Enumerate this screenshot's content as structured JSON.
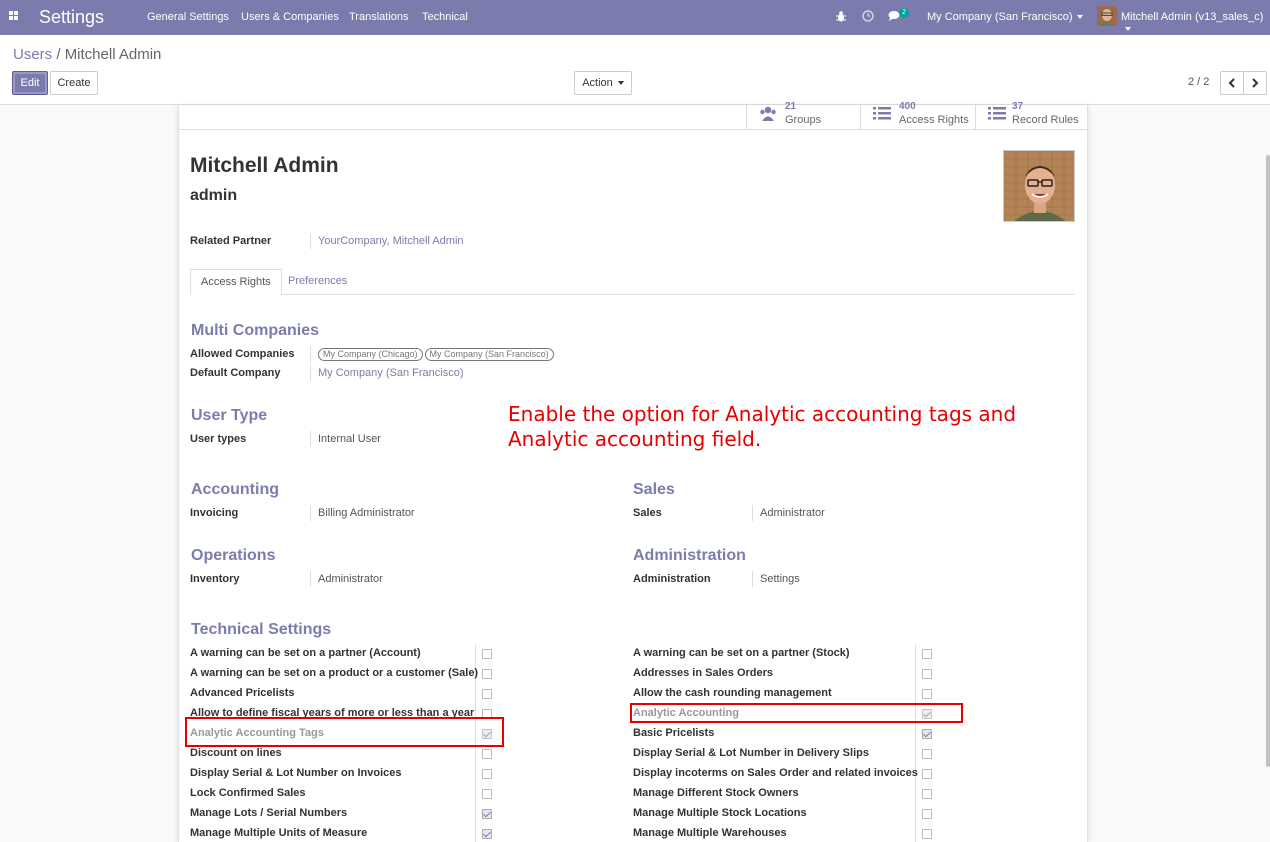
{
  "navbar": {
    "app_title": "Settings",
    "menu": [
      "General Settings",
      "Users & Companies",
      "Translations",
      "Technical"
    ],
    "chat_badge": "2",
    "company_switcher": "My Company (San Francisco)",
    "user_menu": "Mitchell Admin (v13_sales_c)",
    "bg_color": "#7c7bad",
    "icons": [
      "apps-icon",
      "bug-icon",
      "clock-icon",
      "chat-icon"
    ]
  },
  "breadcrumb": {
    "parent": "Users",
    "separator": "/",
    "current": "Mitchell Admin"
  },
  "toolbar": {
    "edit_label": "Edit",
    "create_label": "Create",
    "action_label": "Action",
    "pager": "2 / 2"
  },
  "stats": [
    {
      "count": "21",
      "label": "Groups",
      "icon": "users-icon"
    },
    {
      "count": "400",
      "label": "Access Rights",
      "icon": "list-icon"
    },
    {
      "count": "37",
      "label": "Record Rules",
      "icon": "list-icon"
    }
  ],
  "user": {
    "name": "Mitchell Admin",
    "login": "admin",
    "related_partner_label": "Related Partner",
    "related_partner_value": "YourCompany, Mitchell Admin"
  },
  "tabs": [
    "Access Rights",
    "Preferences"
  ],
  "multi_companies": {
    "title": "Multi Companies",
    "allowed_label": "Allowed Companies",
    "allowed_values": [
      "My Company (Chicago)",
      "My Company (San Francisco)"
    ],
    "default_label": "Default Company",
    "default_value": "My Company (San Francisco)"
  },
  "user_type": {
    "title": "User Type",
    "label": "User types",
    "value": "Internal User"
  },
  "annotation": {
    "line1": "Enable the option for Analytic accounting tags and",
    "line2": "Analytic accounting field.",
    "color": "#e60000"
  },
  "accounting": {
    "title": "Accounting",
    "label": "Invoicing",
    "value": "Billing Administrator"
  },
  "sales": {
    "title": "Sales",
    "label": "Sales",
    "value": "Administrator"
  },
  "operations": {
    "title": "Operations",
    "label": "Inventory",
    "value": "Administrator"
  },
  "administration": {
    "title": "Administration",
    "label": "Administration",
    "value": "Settings"
  },
  "technical": {
    "title": "Technical Settings",
    "left": [
      {
        "label": "A warning can be set on a partner (Account)",
        "checked": false
      },
      {
        "label": "A warning can be set on a product or a customer (Sale)",
        "checked": false
      },
      {
        "label": "Advanced Pricelists",
        "checked": false
      },
      {
        "label": "Allow to define fiscal years of more or less than a year",
        "checked": false
      },
      {
        "label": "Analytic Accounting Tags",
        "checked": true,
        "muted": true
      },
      {
        "label": "Discount on lines",
        "checked": false
      },
      {
        "label": "Display Serial & Lot Number on Invoices",
        "checked": false
      },
      {
        "label": "Lock Confirmed Sales",
        "checked": false
      },
      {
        "label": "Manage Lots / Serial Numbers",
        "checked": true
      },
      {
        "label": "Manage Multiple Units of Measure",
        "checked": true
      }
    ],
    "right": [
      {
        "label": "A warning can be set on a partner (Stock)",
        "checked": false
      },
      {
        "label": "Addresses in Sales Orders",
        "checked": false
      },
      {
        "label": "Allow the cash rounding management",
        "checked": false
      },
      {
        "label": "Analytic Accounting",
        "checked": true,
        "muted": true
      },
      {
        "label": "Basic Pricelists",
        "checked": true
      },
      {
        "label": "Display Serial & Lot Number in Delivery Slips",
        "checked": false
      },
      {
        "label": "Display incoterms on Sales Order and related invoices",
        "checked": false
      },
      {
        "label": "Manage Different Stock Owners",
        "checked": false
      },
      {
        "label": "Manage Multiple Stock Locations",
        "checked": false
      },
      {
        "label": "Manage Multiple Warehouses",
        "checked": false
      }
    ]
  }
}
